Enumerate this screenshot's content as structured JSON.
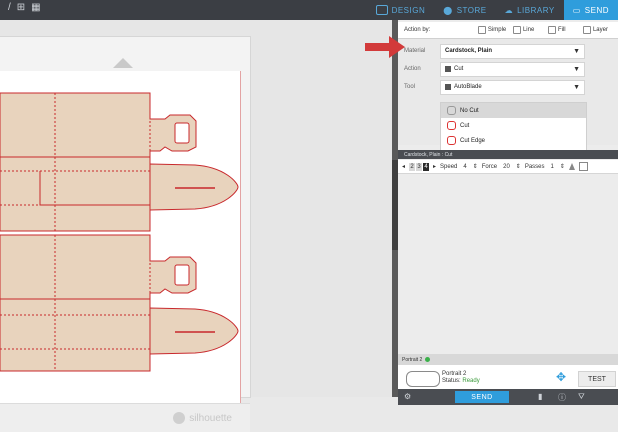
{
  "tabs": [
    {
      "label": "DESIGN"
    },
    {
      "label": "STORE"
    },
    {
      "label": "LIBRARY"
    },
    {
      "label": "SEND"
    }
  ],
  "action_by": {
    "label": "Action by:",
    "options": [
      "Simple",
      "Line",
      "Fill",
      "Layer"
    ]
  },
  "settings": {
    "material_label": "Material",
    "material_value": "Cardstock, Plain",
    "action_label": "Action",
    "action_value": "Cut",
    "tool_label": "Tool",
    "tool_value": "AutoBlade",
    "dropdown_items": [
      "No Cut",
      "Cut",
      "Cut Edge"
    ]
  },
  "pen_bar": "Cardstock, Plain : Cut",
  "cut_settings": {
    "blade_values": [
      "2",
      "3",
      "4"
    ],
    "speed_label": "Speed",
    "speed_value": "4",
    "force_label": "Force",
    "force_value": "20",
    "passes_label": "Passes",
    "passes_value": "1"
  },
  "device": {
    "header": "Portrait 2",
    "name": "Portrait 2",
    "status_label": "Status:",
    "status_value": "Ready",
    "test_label": "TEST"
  },
  "send_label": "SEND",
  "brand": "silhouette"
}
